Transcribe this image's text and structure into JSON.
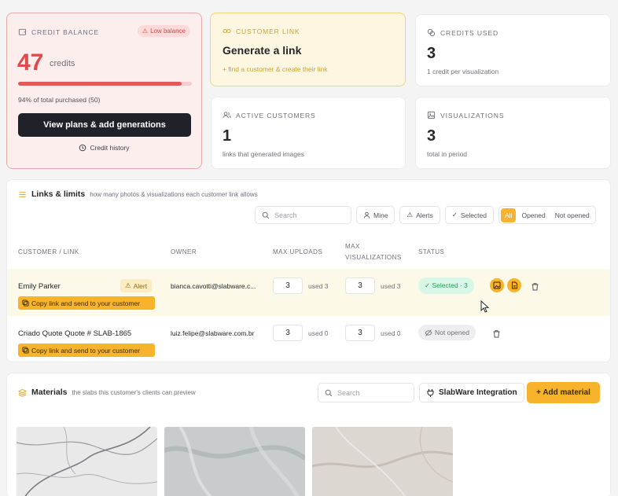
{
  "credit": {
    "label": "CREDIT BALANCE",
    "badge": "Low balance",
    "value": "47",
    "unit": "credits",
    "percent_remaining": 94,
    "percent_text": "94% of total purchased (50)",
    "cta": "View plans & add generations",
    "history": "Credit history",
    "colors": {
      "accent": "#e04a4a",
      "bg": "#fdeeee"
    }
  },
  "customer_link": {
    "label": "CUSTOMER LINK",
    "title": "Generate a link",
    "sub": "+ find a customer & create their link"
  },
  "credits_used": {
    "label": "CREDITS USED",
    "value": "3",
    "sub": "1 credit per visualization",
    "icon": "coins-icon"
  },
  "active_customers": {
    "label": "ACTIVE CUSTOMERS",
    "value": "1",
    "sub": "links that generated images",
    "icon": "users-icon"
  },
  "visualizations": {
    "label": "VISUALIZATIONS",
    "value": "3",
    "sub": "total in period",
    "icon": "gallery-icon"
  },
  "links": {
    "title": "Links & limits",
    "subtitle": "how many photos & visualizations each customer link allows",
    "search_placeholder": "Search",
    "chips": {
      "mine": "Mine",
      "alerts": "Alerts",
      "selected": "Selected"
    },
    "segments": [
      "All",
      "Opened",
      "Not opened"
    ],
    "active_segment": "All",
    "columns": {
      "customer": "CUSTOMER / LINK",
      "owner": "OWNER",
      "max_uploads": "MAX UPLOADS",
      "max_viz_1": "MAX",
      "max_viz_2": "VISUALIZATIONS",
      "status": "STATUS"
    },
    "rows": [
      {
        "name": "Emily Parker",
        "alert": "Alert",
        "copy": "Copy link and send to your customer",
        "owner": "bianca.cavotti@slabware.c...",
        "max_uploads": "3",
        "uploads_used": "used 3",
        "max_viz": "3",
        "viz_used": "used 3",
        "status": "✓ Selected · 3"
      },
      {
        "name": "Criado Quote Quote # SLAB-1865",
        "copy": "Copy link and send to your customer",
        "owner": "luiz.felipe@slabware.com.br",
        "max_uploads": "3",
        "uploads_used": "used 0",
        "max_viz": "3",
        "viz_used": "used 0",
        "status": "Not opened"
      }
    ],
    "colors": {
      "brand": "#f7b32b",
      "selected_text": "#22a05a"
    }
  },
  "materials": {
    "title": "Materials",
    "subtitle": "the slabs this customer's clients can preview",
    "search_placeholder": "Search",
    "integration": "SlabWare Integration",
    "add": "+ Add material"
  }
}
